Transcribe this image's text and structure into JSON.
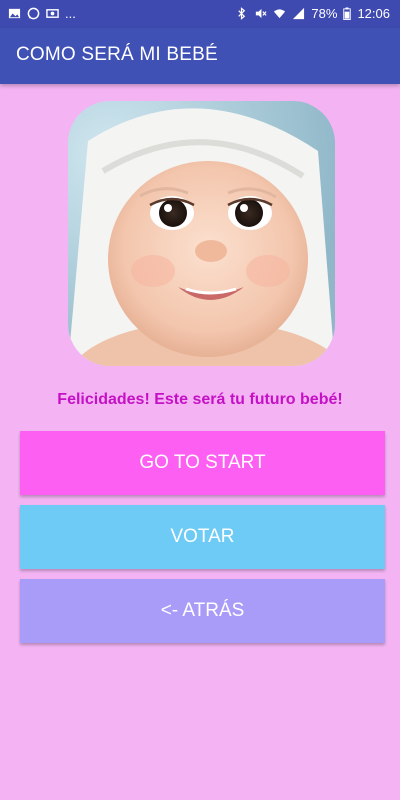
{
  "status_bar": {
    "battery": "78%",
    "time": "12:06",
    "notification_overflow": "...",
    "icons_left": [
      "gallery-icon",
      "whatsapp-icon",
      "money-icon"
    ],
    "icons_right": [
      "bluetooth-icon",
      "mute-icon",
      "wifi-icon",
      "signal-icon",
      "battery-icon"
    ]
  },
  "app_bar": {
    "title": "COMO SERÁ MI BEBÉ"
  },
  "main": {
    "message": "Felicidades! Este será tu futuro bebé!",
    "buttons": [
      {
        "label": "GO TO START",
        "color": "#fd5ff3"
      },
      {
        "label": "VOTAR",
        "color": "#6dcbf6"
      },
      {
        "label": "<- ATRÁS",
        "color": "#a99cf9"
      }
    ]
  },
  "colors": {
    "background": "#f4b4f4",
    "app_bar": "#3f51b5",
    "status_bar": "#3f4ab0",
    "message_text": "#c511c5"
  }
}
